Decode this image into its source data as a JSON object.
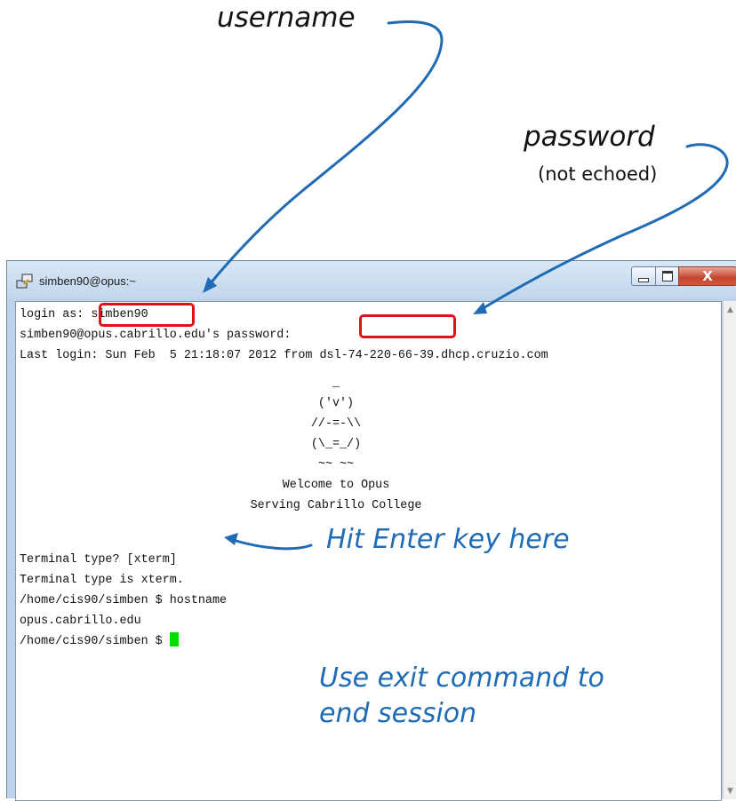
{
  "annotations": {
    "username": "username",
    "password": "password",
    "password_note": "(not echoed)",
    "hit_enter": "Hit Enter key here",
    "exit_line1": "Use exit command to",
    "exit_line2": "end session"
  },
  "window": {
    "title": "simben90@opus:~",
    "icon": "putty-icon",
    "buttons": {
      "close": "X"
    }
  },
  "terminal": {
    "line1_prompt": "login as: ",
    "line1_user": "simben90",
    "line2": "simben90@opus.cabrillo.edu's password:",
    "line3": "Last login: Sun Feb  5 21:18:07 2012 from dsl-74-220-66-39.dhcp.cruzio.com",
    "ascii_art": "_\n('v')\n//-=-\\\\\n(\\_=_/)\n~~ ~~",
    "welcome": "Welcome to Opus",
    "serving": "Serving Cabrillo College",
    "line4": "Terminal type? [xterm]",
    "line5": "Terminal type is xterm.",
    "line6": "/home/cis90/simben $ hostname",
    "line7": "opus.cabrillo.edu",
    "line8": "/home/cis90/simben $ "
  },
  "colors": {
    "annotation_blue": "#1f6bb5",
    "highlight_red": "#e0101a",
    "cursor_green": "#00e000"
  }
}
